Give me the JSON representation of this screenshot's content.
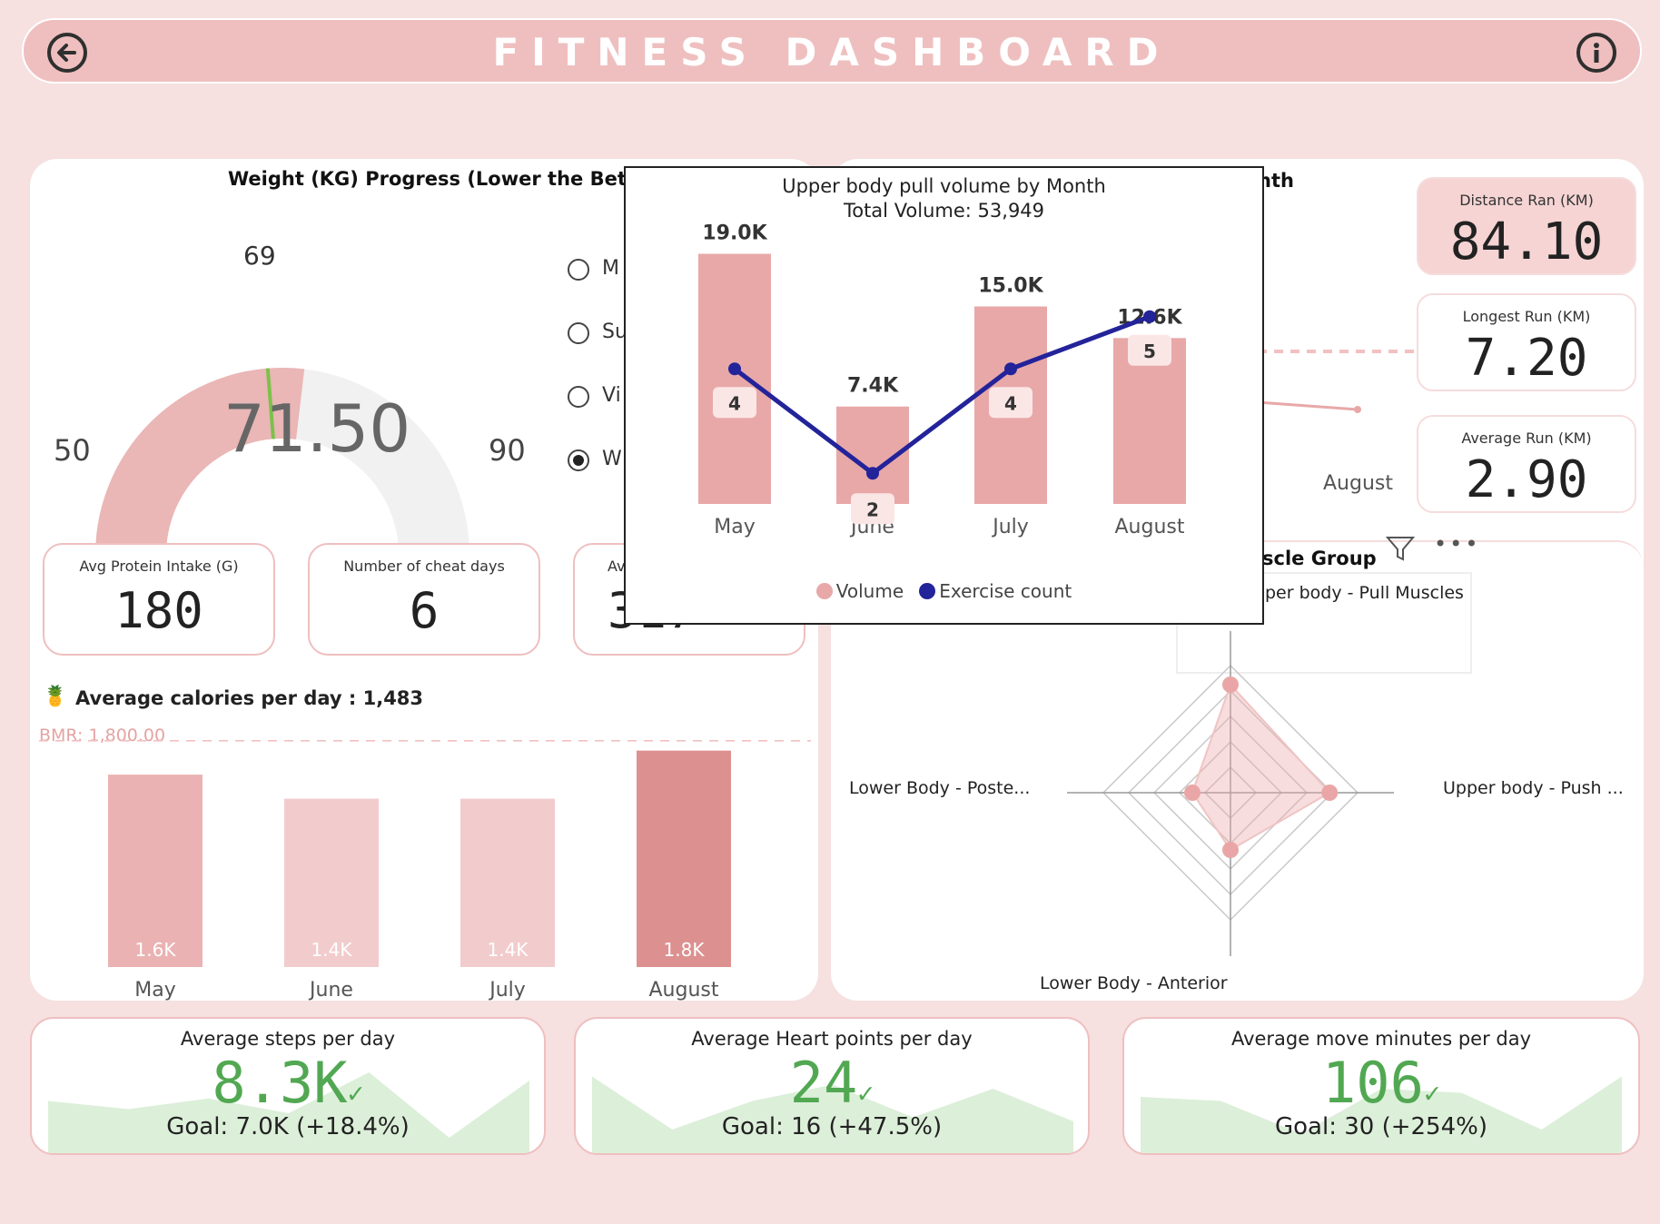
{
  "header": {
    "title": "FITNESS DASHBOARD",
    "back_icon": "arrow-left-circle-icon",
    "info_icon": "info-circle-icon"
  },
  "weight": {
    "title": "Weight (KG) Progress (Lower the Better)",
    "value": "71.50",
    "min": "50",
    "max": "90",
    "target": "69",
    "gauge_value": 71.5,
    "gauge_min": 50,
    "gauge_max": 90,
    "gauge_target": 69
  },
  "radio_options": [
    {
      "label": "M",
      "selected": false
    },
    {
      "label": "Su",
      "selected": false
    },
    {
      "label": "Vi",
      "selected": false
    },
    {
      "label": "W",
      "selected": true
    }
  ],
  "cards": {
    "protein": {
      "label": "Avg Protein Intake (G)",
      "value": "180"
    },
    "cheat": {
      "label": "Number of cheat days",
      "value": "6"
    },
    "third": {
      "label": "Av",
      "value": "317"
    }
  },
  "calories": {
    "title": "Average calories per day : 1,483",
    "bmr_label": "BMR: 1,800.00",
    "chart_data": {
      "type": "bar",
      "categories": [
        "May",
        "June",
        "July",
        "August"
      ],
      "values": [
        1600,
        1400,
        1400,
        1800
      ],
      "labels": [
        "1.6K",
        "1.4K",
        "1.4K",
        "1.8K"
      ],
      "reference_line": 1800,
      "ylim": [
        0,
        1850
      ]
    }
  },
  "right_kpis": {
    "distance": {
      "label": "Distance Ran (KM)",
      "value": "84.10"
    },
    "longest": {
      "label": "Longest Run (KM)",
      "value": "7.20"
    },
    "average": {
      "label": "Average Run (KM)",
      "value": "2.90"
    }
  },
  "right_chart": {
    "title_fragment": "nth",
    "x_label": "August"
  },
  "muscle": {
    "title_fragment": "scle Group",
    "selected_fragment": "per body - Pull Muscles",
    "filter_icon": "filter-icon",
    "more_icon": "more-options-icon",
    "chart_data": {
      "type": "radar",
      "axes": [
        "Upper body - Pull Muscles",
        "Upper body - Push ...",
        "Lower Body - Anterior",
        "Lower Body - Poste..."
      ],
      "values": [
        0.85,
        0.78,
        0.45,
        0.3
      ]
    },
    "axis_labels": {
      "right": "Upper body - Push ...",
      "bottom": "Lower Body - Anterior",
      "left": "Lower Body - Poste..."
    }
  },
  "bottom": {
    "steps": {
      "label": "Average steps per day",
      "value": "8.3K",
      "goal": "Goal: 7.0K (+18.4%)",
      "trend": [
        0.55,
        0.45,
        0.58,
        0.4,
        0.9,
        0.1,
        0.8
      ]
    },
    "heart": {
      "label": "Average Heart points per day",
      "value": "24",
      "goal": "Goal: 16 (+47.5%)",
      "trend": [
        0.85,
        0.2,
        0.55,
        0.75,
        0.35,
        0.7,
        0.3
      ]
    },
    "move": {
      "label": "Average move minutes per day",
      "value": "106",
      "goal": "Goal: 30 (+254%)",
      "trend": [
        0.6,
        0.55,
        0.15,
        0.7,
        0.65,
        0.2,
        0.85
      ]
    },
    "check_icon": "check-icon"
  },
  "popup": {
    "title": "Upper body pull volume by Month",
    "subtitle": "Total Volume: 53,949",
    "legend": [
      "Volume",
      "Exercise count"
    ],
    "chart_data": {
      "type": "bar",
      "categories": [
        "May",
        "June",
        "July",
        "August"
      ],
      "series": [
        {
          "name": "Volume",
          "values": [
            19000,
            7400,
            15000,
            12600
          ],
          "labels": [
            "19.0K",
            "7.4K",
            "15.0K",
            "12.6K"
          ]
        },
        {
          "name": "Exercise count",
          "values": [
            4,
            2,
            4,
            5
          ]
        }
      ],
      "ylim": [
        0,
        20000
      ]
    },
    "colors": {
      "bar": "#e8a8a8",
      "line": "#23239a"
    }
  }
}
